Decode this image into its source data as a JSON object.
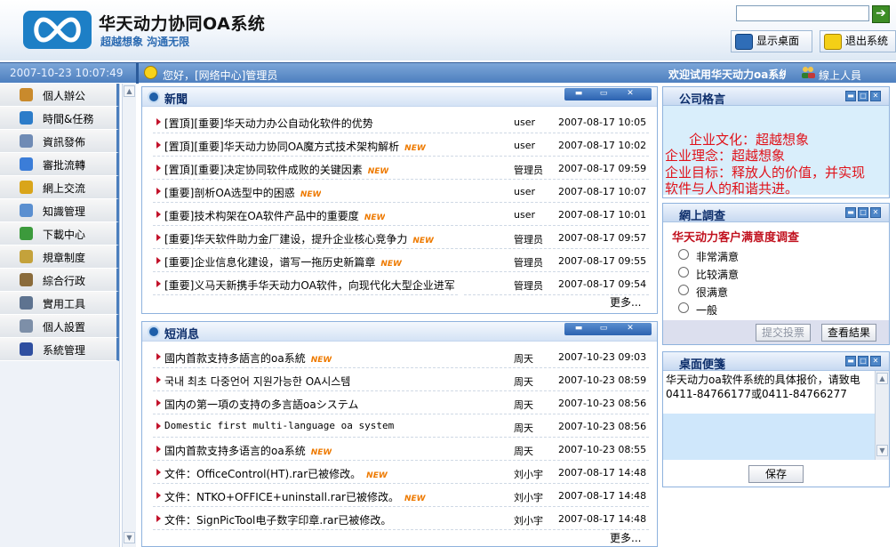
{
  "app": {
    "title": "华天动力协同OA系统",
    "slogan": "超越想象 沟通无限"
  },
  "header": {
    "search_value": "",
    "go_icon": "arrow-right-icon",
    "desktop_button": "显示桌面",
    "exit_button": "退出系统"
  },
  "status": {
    "datetime": "2007-10-23 10:07:49",
    "greeting": "您好，[网络中心]管理员",
    "welcome": "欢迎试用华天动力oa系统",
    "online_label": "線上人員"
  },
  "sidebar": {
    "items": [
      {
        "label": "個人辦公",
        "icon": "person-icon",
        "color": "#c98a2c"
      },
      {
        "label": "時間&任務",
        "icon": "globe-icon",
        "color": "#2c7cc9"
      },
      {
        "label": "資訊發佈",
        "icon": "document-icon",
        "color": "#6f8bb5"
      },
      {
        "label": "審批流轉",
        "icon": "check-icon",
        "color": "#3b7dd8"
      },
      {
        "label": "網上交流",
        "icon": "chat-icon",
        "color": "#d9a51b"
      },
      {
        "label": "知識管理",
        "icon": "book-icon",
        "color": "#5a8fd0"
      },
      {
        "label": "下載中心",
        "icon": "download-icon",
        "color": "#3c9a3c"
      },
      {
        "label": "規章制度",
        "icon": "rules-icon",
        "color": "#c4a23b"
      },
      {
        "label": "綜合行政",
        "icon": "building-icon",
        "color": "#8a6b3b"
      },
      {
        "label": "實用工具",
        "icon": "tools-icon",
        "color": "#5e7390"
      },
      {
        "label": "個人設置",
        "icon": "settings-icon",
        "color": "#7d8fa8"
      },
      {
        "label": "系統管理",
        "icon": "cube-icon",
        "color": "#2f4fa0"
      }
    ]
  },
  "news": {
    "title": "新聞",
    "more": "更多...",
    "rows": [
      {
        "title": "[置頂][重要]华天动力办公自动化软件的优势",
        "new": false,
        "author": "user",
        "date": "2007-08-17 10:05"
      },
      {
        "title": "[置頂][重要]华天动力协同OA魔方式技术架构解析",
        "new": true,
        "author": "user",
        "date": "2007-08-17 10:02"
      },
      {
        "title": "[置頂][重要]决定协同软件成败的关键因素",
        "new": true,
        "author": "管理员",
        "date": "2007-08-17 09:59"
      },
      {
        "title": "[重要]剖析OA选型中的困惑",
        "new": true,
        "author": "user",
        "date": "2007-08-17 10:07"
      },
      {
        "title": "[重要]技术构架在OA软件产品中的重要度",
        "new": true,
        "author": "user",
        "date": "2007-08-17 10:01"
      },
      {
        "title": "[重要]华天软件助力金厂建设，提升企业核心竞争力",
        "new": true,
        "author": "管理员",
        "date": "2007-08-17 09:57"
      },
      {
        "title": "[重要]企业信息化建设，谱写一拖历史新篇章",
        "new": true,
        "author": "管理员",
        "date": "2007-08-17 09:55"
      },
      {
        "title": "[重要]义马天新携手华天动力OA软件，向现代化大型企业进军",
        "new": false,
        "author": "管理员",
        "date": "2007-08-17 09:54"
      }
    ]
  },
  "messages": {
    "title": "短消息",
    "more": "更多...",
    "rows": [
      {
        "title": "國内首款支持多語言的oa系統",
        "new": true,
        "author": "周天",
        "date": "2007-10-23 09:03"
      },
      {
        "title": "국내 최초 다중언어 지원가능한 OA시스템",
        "new": false,
        "author": "周天",
        "date": "2007-10-23 08:59"
      },
      {
        "title": "国内の第一項の支持の多言語oaシステム",
        "new": false,
        "author": "周天",
        "date": "2007-10-23 08:56"
      },
      {
        "title": "Domestic first multi-language oa system",
        "new": false,
        "mono": true,
        "author": "周天",
        "date": "2007-10-23 08:56"
      },
      {
        "title": "国内首款支持多语言的oa系统",
        "new": true,
        "author": "周天",
        "date": "2007-10-23 08:55"
      },
      {
        "title": "文件：OfficeControl(HT).rar已被修改。",
        "new": true,
        "author": "刘小宇",
        "date": "2007-08-17 14:48"
      },
      {
        "title": "文件：NTKO+OFFICE+uninstall.rar已被修改。",
        "new": true,
        "author": "刘小宇",
        "date": "2007-08-17 14:48"
      },
      {
        "title": "文件：SignPicTool电子数字印章.rar已被修改。",
        "new": false,
        "author": "刘小宇",
        "date": "2007-08-17 14:48"
      }
    ]
  },
  "new_badge": "NEW",
  "motto": {
    "title": "公司格言",
    "lines": [
      "企业文化：超越想象",
      "企业理念：超越想象",
      "企业目标：释放人的价值，并实现",
      "软件与人的和谐共进。"
    ]
  },
  "survey": {
    "title": "網上調查",
    "question": "华天动力客户满意度调查",
    "options": [
      "非常满意",
      "比较满意",
      "很满意",
      "一般"
    ],
    "submit": "提交投票",
    "results": "查看結果"
  },
  "notes": {
    "title": "桌面便箋",
    "text": "华天动力oa软件系统的具体报价，请致电0411-84766177或0411-84766277",
    "save": "保存"
  }
}
